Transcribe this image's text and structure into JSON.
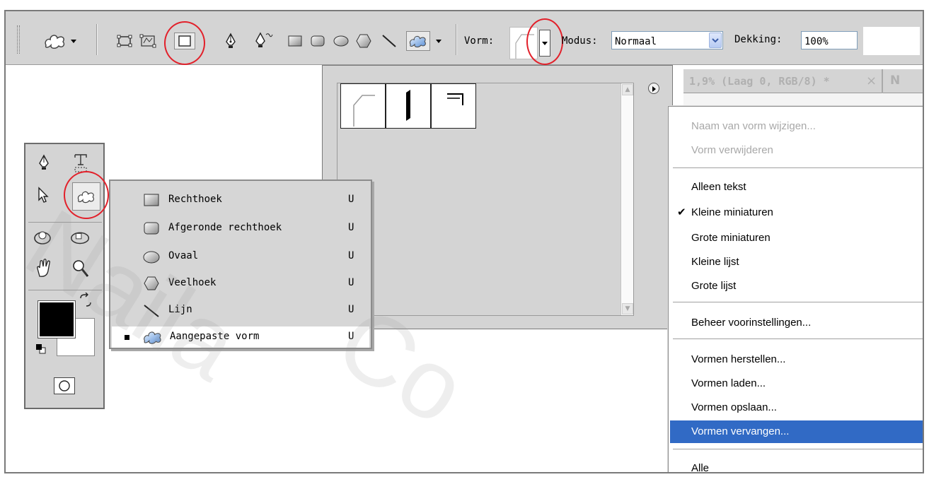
{
  "options_bar": {
    "vorm_label": "Vorm:",
    "modus_label": "Modus:",
    "modus_value": "Normaal",
    "dekking_label": "Dekking:",
    "dekking_value": "100%"
  },
  "document_tab": {
    "title": "1,9% (Laag 0, RGB/8) *",
    "close": "×",
    "next": "N"
  },
  "shape_flyout": {
    "items": [
      {
        "label": "Rechthoek",
        "key": "U"
      },
      {
        "label": "Afgeronde rechthoek",
        "key": "U"
      },
      {
        "label": "Ovaal",
        "key": "U"
      },
      {
        "label": "Veelhoek",
        "key": "U"
      },
      {
        "label": "Lijn",
        "key": "U"
      },
      {
        "label": "Aangepaste vorm",
        "key": "U"
      }
    ]
  },
  "context_menu": {
    "items": [
      {
        "label": "Naam van vorm wijzigen..."
      },
      {
        "label": "Vorm verwijderen"
      },
      {
        "label": "Alleen tekst"
      },
      {
        "label": "Kleine miniaturen"
      },
      {
        "label": "Grote miniaturen"
      },
      {
        "label": "Kleine lijst"
      },
      {
        "label": "Grote lijst"
      },
      {
        "label": "Beheer voorinstellingen..."
      },
      {
        "label": "Vormen herstellen..."
      },
      {
        "label": "Vormen laden..."
      },
      {
        "label": "Vormen opslaan..."
      },
      {
        "label": "Vormen vervangen..."
      },
      {
        "label": "Alle"
      }
    ],
    "check": "✔"
  },
  "watermark": {
    "text1": "Naila",
    "text2": "Co"
  },
  "colors": {
    "highlight": "#316ac5",
    "annotation_red": "#e2202a",
    "panel_gray": "#d4d4d4",
    "foreground_color": "#000000",
    "background_color": "#ffffff"
  }
}
